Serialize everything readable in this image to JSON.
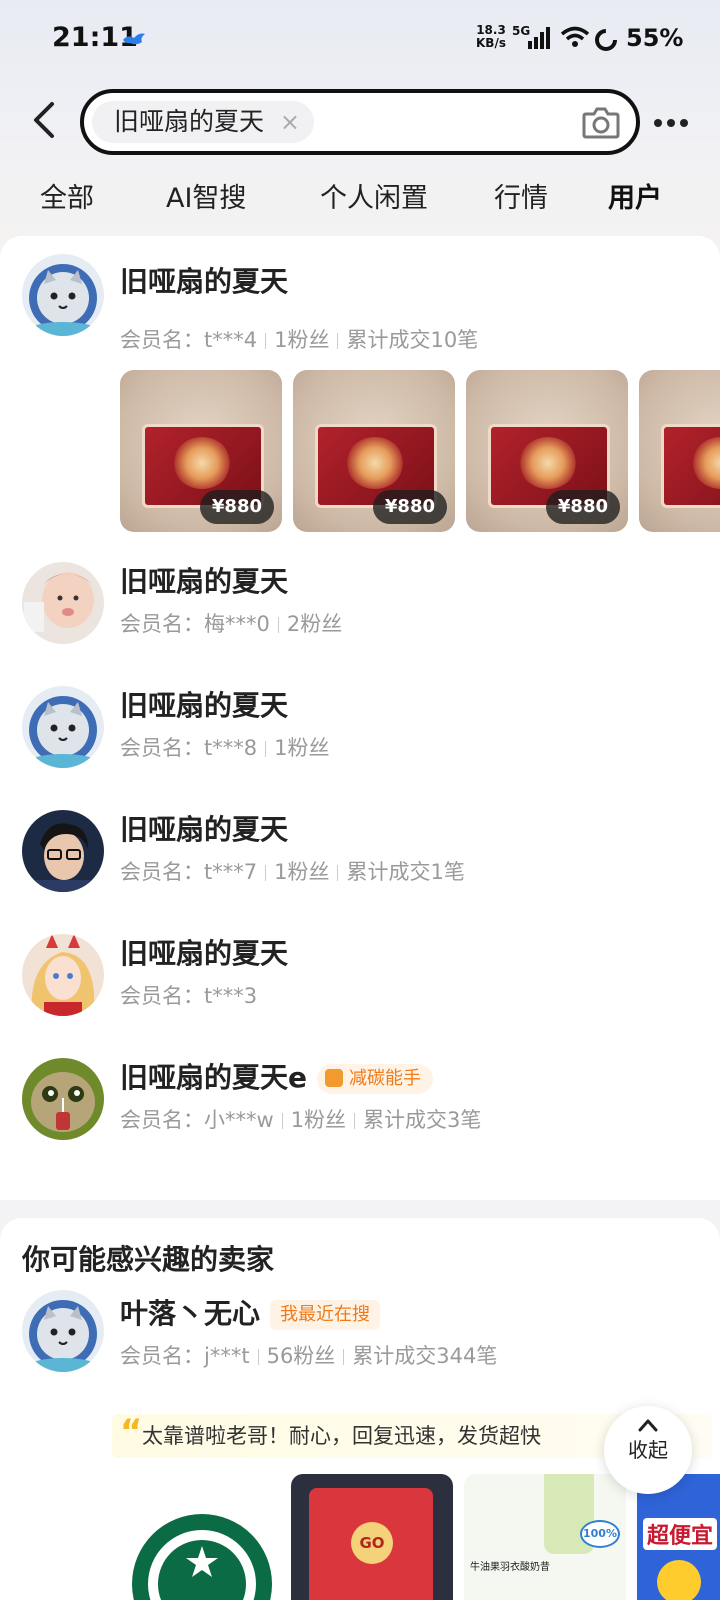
{
  "status_bar": {
    "time": "21:11",
    "net_speed_value": "18.3",
    "net_speed_unit": "KB/s",
    "network": "5G",
    "battery": "55%"
  },
  "search": {
    "query": "旧哑扇的夏天",
    "clear_icon": "×"
  },
  "tabs": [
    {
      "label": "全部"
    },
    {
      "label": "AI智搜"
    },
    {
      "label": "个人闲置"
    },
    {
      "label": "行情"
    },
    {
      "label": "用户",
      "active": true
    }
  ],
  "users": [
    {
      "name": "旧哑扇的夏天",
      "member_label": "会员名：",
      "member_id": "t***4",
      "fans": "1粉丝",
      "deals": "累计成交10笔",
      "avatar": "cat-astronaut",
      "items": [
        {
          "price": "¥880"
        },
        {
          "price": "¥880"
        },
        {
          "price": "¥880"
        }
      ]
    },
    {
      "name": "旧哑扇的夏天",
      "member_label": "会员名：",
      "member_id": "梅***0",
      "fans": "2粉丝",
      "avatar": "baby-photo"
    },
    {
      "name": "旧哑扇的夏天",
      "member_label": "会员名：",
      "member_id": "t***8",
      "fans": "1粉丝",
      "avatar": "cat-astronaut"
    },
    {
      "name": "旧哑扇的夏天",
      "member_label": "会员名：",
      "member_id": "t***7",
      "fans": "1粉丝",
      "deals": "累计成交1笔",
      "avatar": "person-glasses"
    },
    {
      "name": "旧哑扇的夏天",
      "member_label": "会员名：",
      "member_id": "t***3",
      "avatar": "anime-girl"
    },
    {
      "name": "旧哑扇的夏天e",
      "badge": "减碳能手",
      "member_label": "会员名：",
      "member_id": "小***w",
      "fans": "1粉丝",
      "deals": "累计成交3笔",
      "avatar": "green-cat"
    }
  ],
  "recommendation": {
    "title_prefix": "你可能",
    "title_highlight": "感兴趣的",
    "title_suffix": "卖家",
    "seller": {
      "name": "叶落丶无心",
      "tag": "我最近在搜",
      "member_label": "会员名：",
      "member_id": "j***t",
      "fans": "56粉丝",
      "deals": "累计成交344笔",
      "review": "太靠谱啦老哥！耐心，回复迅速，发货超快"
    },
    "thumb_texts": {
      "go": "GO",
      "product": "牛油果羽衣酸奶昔",
      "percent": "100%",
      "promo": "超便宜"
    }
  },
  "collapse_label": "收起",
  "colors": {
    "accent_yellow": "#ffe033",
    "badge_orange": "#f07a1a",
    "price_pill": "#1e1e1e"
  }
}
